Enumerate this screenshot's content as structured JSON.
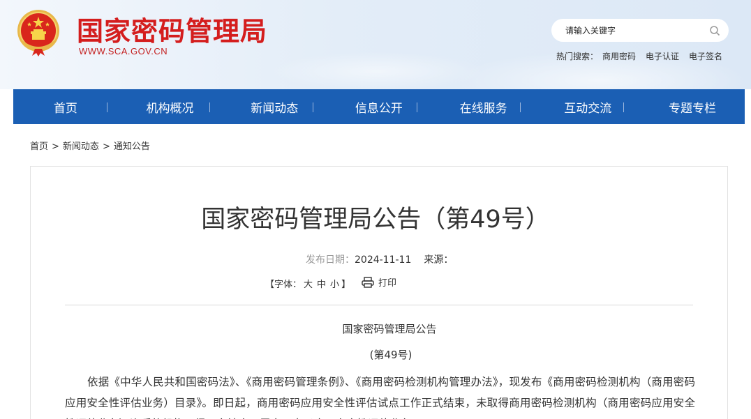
{
  "header": {
    "site_title": "国家密码管理局",
    "site_url": "WWW.SCA.GOV.CN",
    "emblem_icon": "national-emblem-icon",
    "search": {
      "placeholder": "请输入关键字",
      "icon": "search-icon"
    },
    "hot_search": {
      "label": "热门搜索：",
      "items": [
        "商用密码",
        "电子认证",
        "电子签名"
      ]
    }
  },
  "nav": {
    "items": [
      "首页",
      "机构概况",
      "新闻动态",
      "信息公开",
      "在线服务",
      "互动交流",
      "专题专栏"
    ]
  },
  "breadcrumb": [
    "首页",
    "新闻动态",
    "通知公告"
  ],
  "breadcrumb_sep": ">",
  "article": {
    "title": "国家密码管理局公告（第49号）",
    "date_label": "发布日期：",
    "date": "2024-11-11",
    "source_label": "来源：",
    "source": "",
    "font_label_open": "【字体：",
    "font_sizes": [
      "大",
      "中",
      "小"
    ],
    "font_label_close": "】",
    "print_label": "打印",
    "subtitle": "国家密码管理局公告",
    "doc_no": "(第49号)",
    "body": "依据《中华人民共和国密码法》、《商用密码管理条例》、《商用密码检测机构管理办法》，现发布《商用密码检测机构（商用密码应用安全性评估业务）目录》。即日起，商用密码应用安全性评估试点工作正式结束，未取得商用密码检测机构（商用密码应用安全性评估业务）资质的机构不得面向社会开展商用密码应用安全性评估业务。"
  },
  "colors": {
    "brand_red": "#d41d1d",
    "nav_blue": "#1b5fb4"
  }
}
